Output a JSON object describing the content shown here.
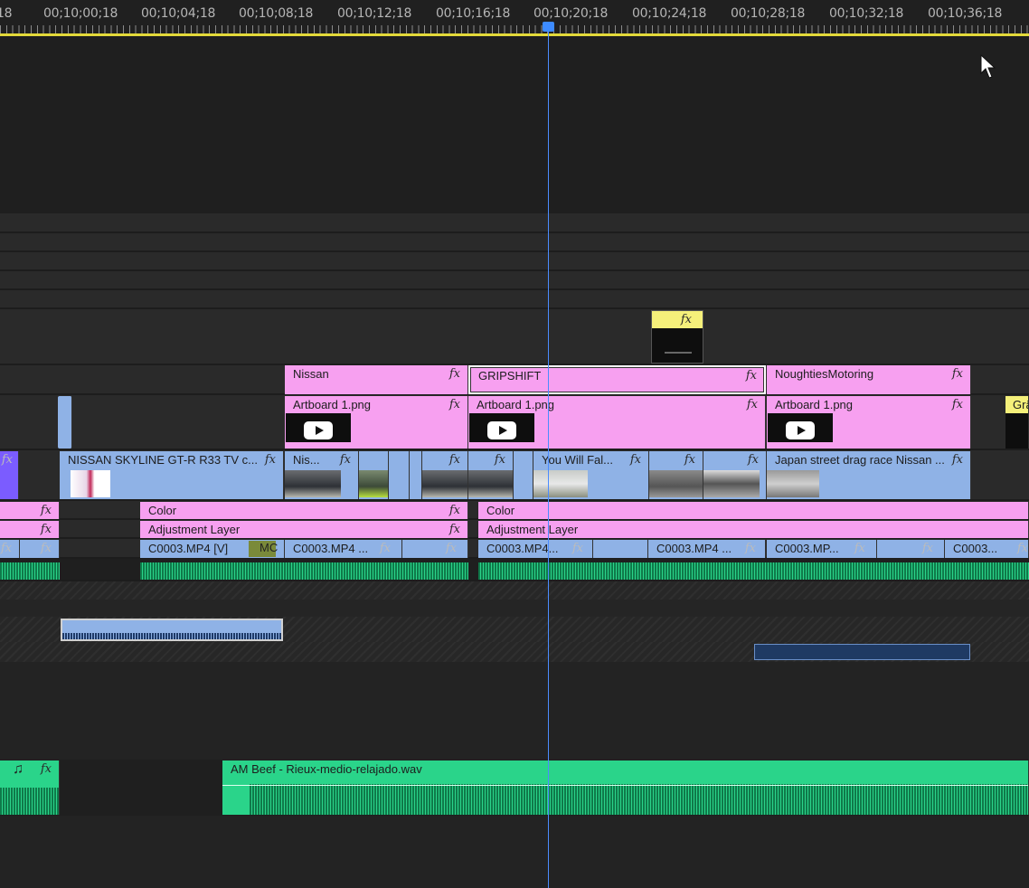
{
  "ruler": {
    "timecodes": [
      "18",
      "00;10;00;18",
      "00;10;04;18",
      "00;10;08;18",
      "00;10;12;18",
      "00;10;16;18",
      "00;10;20;18",
      "00;10;24;18",
      "00;10;28;18",
      "00;10;32;18",
      "00;10;36;18"
    ]
  },
  "colors": {
    "pink": "#f7a0f0",
    "blue": "#8fb2e6",
    "green": "#2ad48a",
    "playhead": "#4b8cff",
    "ruler_line": "#e3d93a",
    "yellow": "#f5f07a"
  },
  "icons": {
    "fx": "fx-badge-icon",
    "music": "music-note-icon",
    "play": "youtube-play-icon",
    "cursor": "mouse-pointer-icon"
  },
  "fx_label": "fx",
  "music_glyph": "♫",
  "v6": {
    "clip_fx": "fx"
  },
  "v5": {
    "nissan": "Nissan",
    "gripshift": "GRIPSHIFT",
    "noughties": "NoughtiesMotoring"
  },
  "v4": {
    "artboard1": "Artboard 1.png",
    "artboard2": "Artboard 1.png",
    "artboard3": "Artboard 1.png",
    "partial": "Grä"
  },
  "v3": {
    "nissan_skyline": "NISSAN SKYLINE GT-R R33  TV c...",
    "nis": "Nis...",
    "you_will_fall": "You Will Fal...",
    "japan_street": "Japan street drag race Nissan ..."
  },
  "v2": {
    "color1": "Color",
    "color2": "Color"
  },
  "v1b": {
    "adj1": "Adjustment Layer",
    "adj2": "Adjustment Layer"
  },
  "v1": {
    "c1": "C0003.MP4 [V]",
    "mo": "MC",
    "c2": "C0003.MP4 ...",
    "c3": "C0003.MP4...",
    "c4": "C0003.MP4 ...",
    "c5": "C0003.MP...",
    "c6": "C0003..."
  },
  "audio": {
    "music_clip": "AM Beef - Rieux-medio-relajado.wav"
  }
}
